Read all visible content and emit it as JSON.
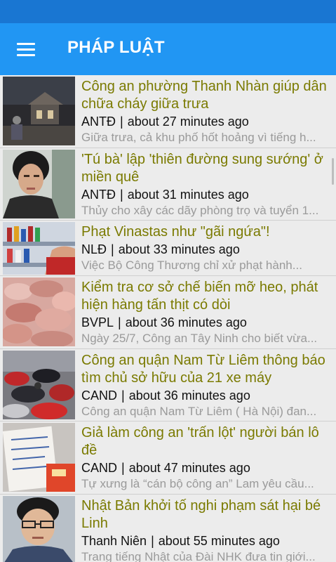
{
  "app": {
    "title": "PHÁP LUẬT"
  },
  "colors": {
    "status_bar": "#1976d2",
    "app_bar": "#2196f3",
    "title_text": "#7a7a00",
    "desc_text": "#9a9a9a"
  },
  "icons": {
    "menu": "hamburger-menu-icon"
  },
  "articles": [
    {
      "title": "Công an phường Thanh Nhàn giúp dân chữa cháy giữa trưa",
      "source": "ANTĐ",
      "time": "about 27 minutes ago",
      "snippet": "Giữa trưa, cả khu phố hốt hoảng vì tiếng h..."
    },
    {
      "title": "'Tú bà' lập 'thiên đường sung sướng' ở miền quê",
      "source": "ANTĐ",
      "time": "about 31 minutes ago",
      "snippet": "Thủy cho xây các dãy phòng trọ và tuyển 1..."
    },
    {
      "title": "Phạt Vinastas như \"gãi ngứa\"!",
      "source": "NLĐ",
      "time": "about 33 minutes ago",
      "snippet": "Việc Bộ Công Thương chỉ xử phạt hành..."
    },
    {
      "title": "Kiểm tra cơ sở chế biến mỡ heo, phát hiện hàng tấn thịt có dòi",
      "source": "BVPL",
      "time": "about 36 minutes ago",
      "snippet": "Ngày 25/7, Công an Tây Ninh cho biết vừa..."
    },
    {
      "title": "Công an quận Nam Từ Liêm thông báo tìm chủ sở hữu của 21 xe máy",
      "source": "CAND",
      "time": "about 36 minutes ago",
      "snippet": "Công an quận Nam Từ Liêm ( Hà Nội) đan..."
    },
    {
      "title": "Giả làm công an 'trấn lột' người bán lô đề",
      "source": "CAND",
      "time": "about 47 minutes ago",
      "snippet": "Tự xưng là “cán bộ công an” Lam yêu cầu..."
    },
    {
      "title": "Nhật Bản khởi tố nghi phạm sát hại bé Linh",
      "source": "Thanh Niên",
      "time": "about 55 minutes ago",
      "snippet": "Trang tiếng Nhật của Đài NHK đưa tin giới..."
    }
  ]
}
